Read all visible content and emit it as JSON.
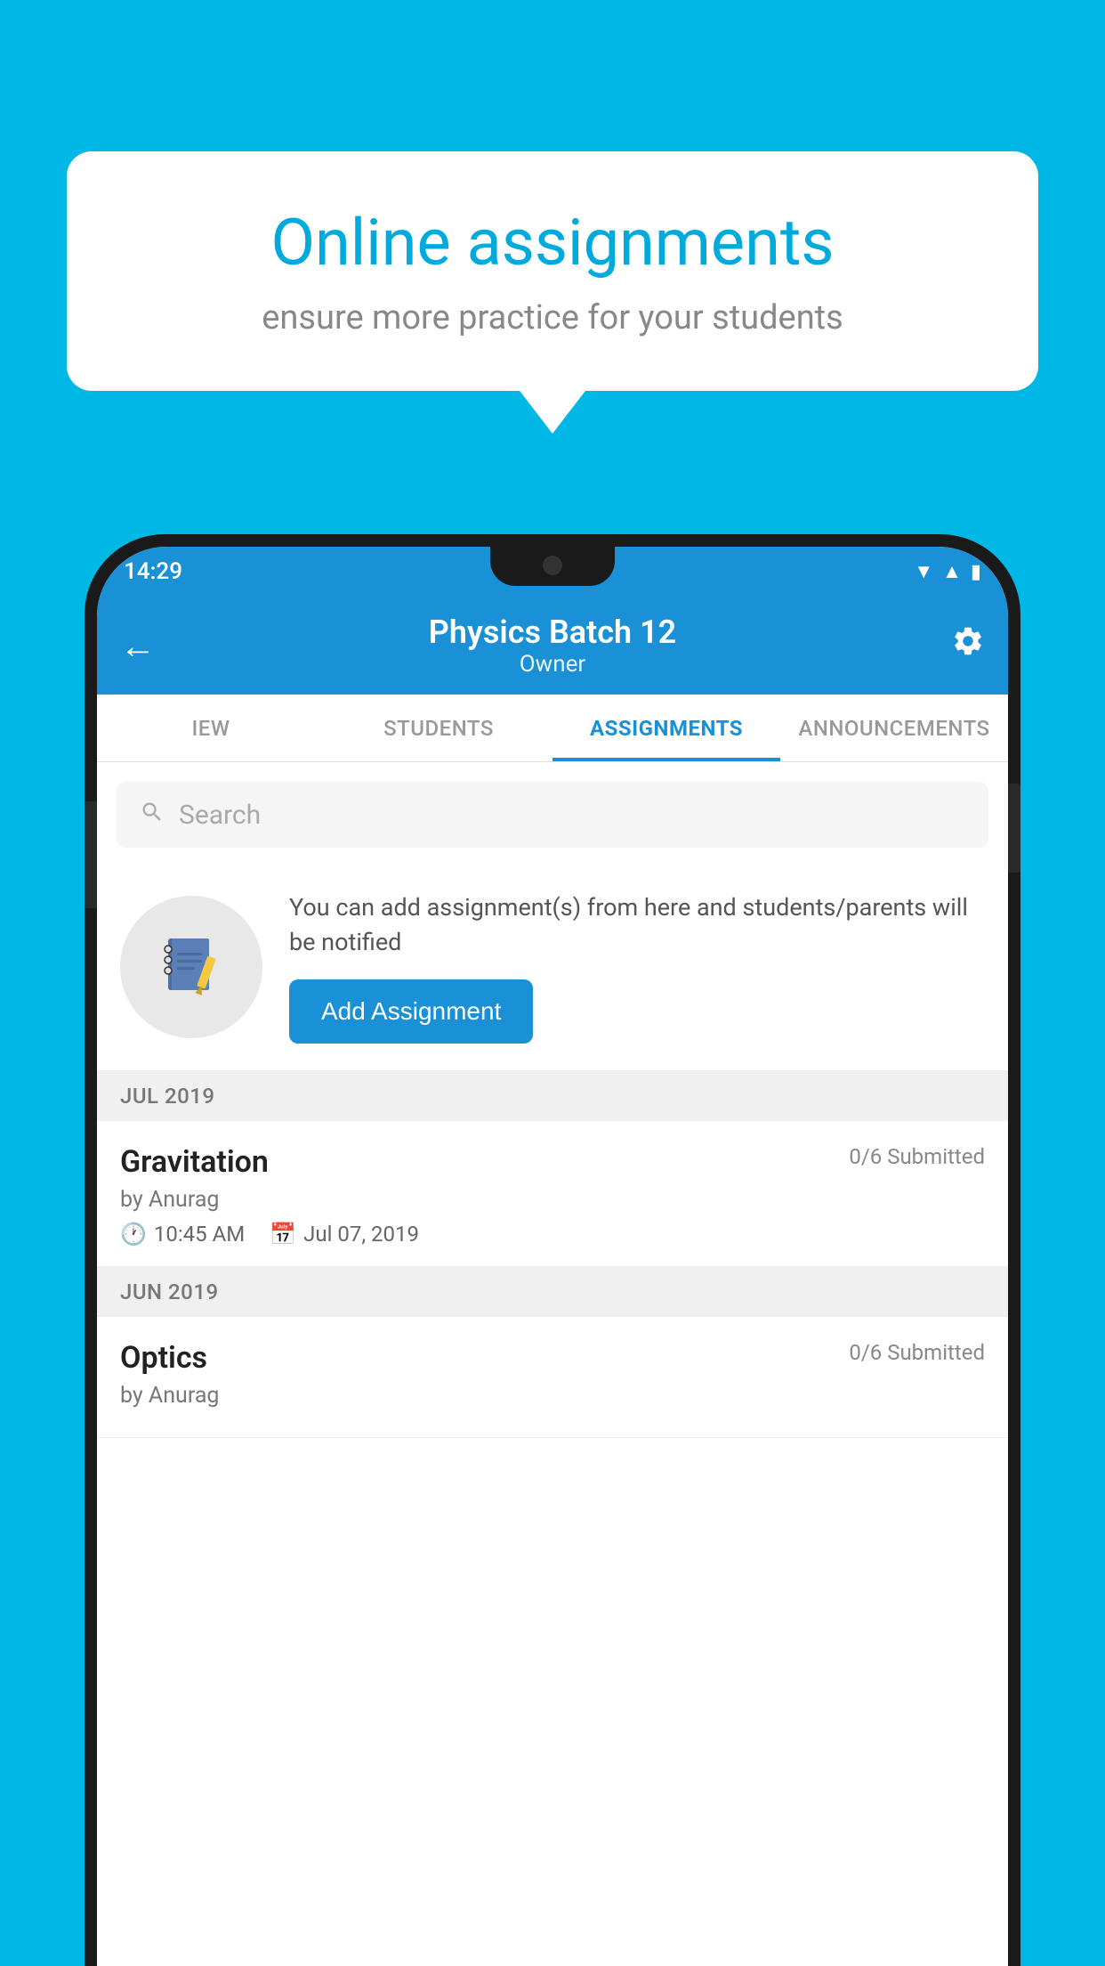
{
  "background_color": "#00b8e6",
  "speech_bubble": {
    "title": "Online assignments",
    "subtitle": "ensure more practice for your students"
  },
  "phone": {
    "status_bar": {
      "time": "14:29",
      "icons": [
        "wifi",
        "signal",
        "battery"
      ]
    },
    "header": {
      "title": "Physics Batch 12",
      "subtitle": "Owner",
      "back_label": "←",
      "settings_label": "⚙"
    },
    "tabs": [
      {
        "label": "IEW",
        "active": false
      },
      {
        "label": "STUDENTS",
        "active": false
      },
      {
        "label": "ASSIGNMENTS",
        "active": true
      },
      {
        "label": "ANNOUNCEMENTS",
        "active": false
      }
    ],
    "search": {
      "placeholder": "Search"
    },
    "promo": {
      "text": "You can add assignment(s) from here and students/parents will be notified",
      "button_label": "Add Assignment"
    },
    "sections": [
      {
        "month": "JUL 2019",
        "assignments": [
          {
            "name": "Gravitation",
            "submitted": "0/6 Submitted",
            "by": "by Anurag",
            "time": "10:45 AM",
            "date": "Jul 07, 2019"
          }
        ]
      },
      {
        "month": "JUN 2019",
        "assignments": [
          {
            "name": "Optics",
            "submitted": "0/6 Submitted",
            "by": "by Anurag",
            "time": "",
            "date": ""
          }
        ]
      }
    ]
  }
}
